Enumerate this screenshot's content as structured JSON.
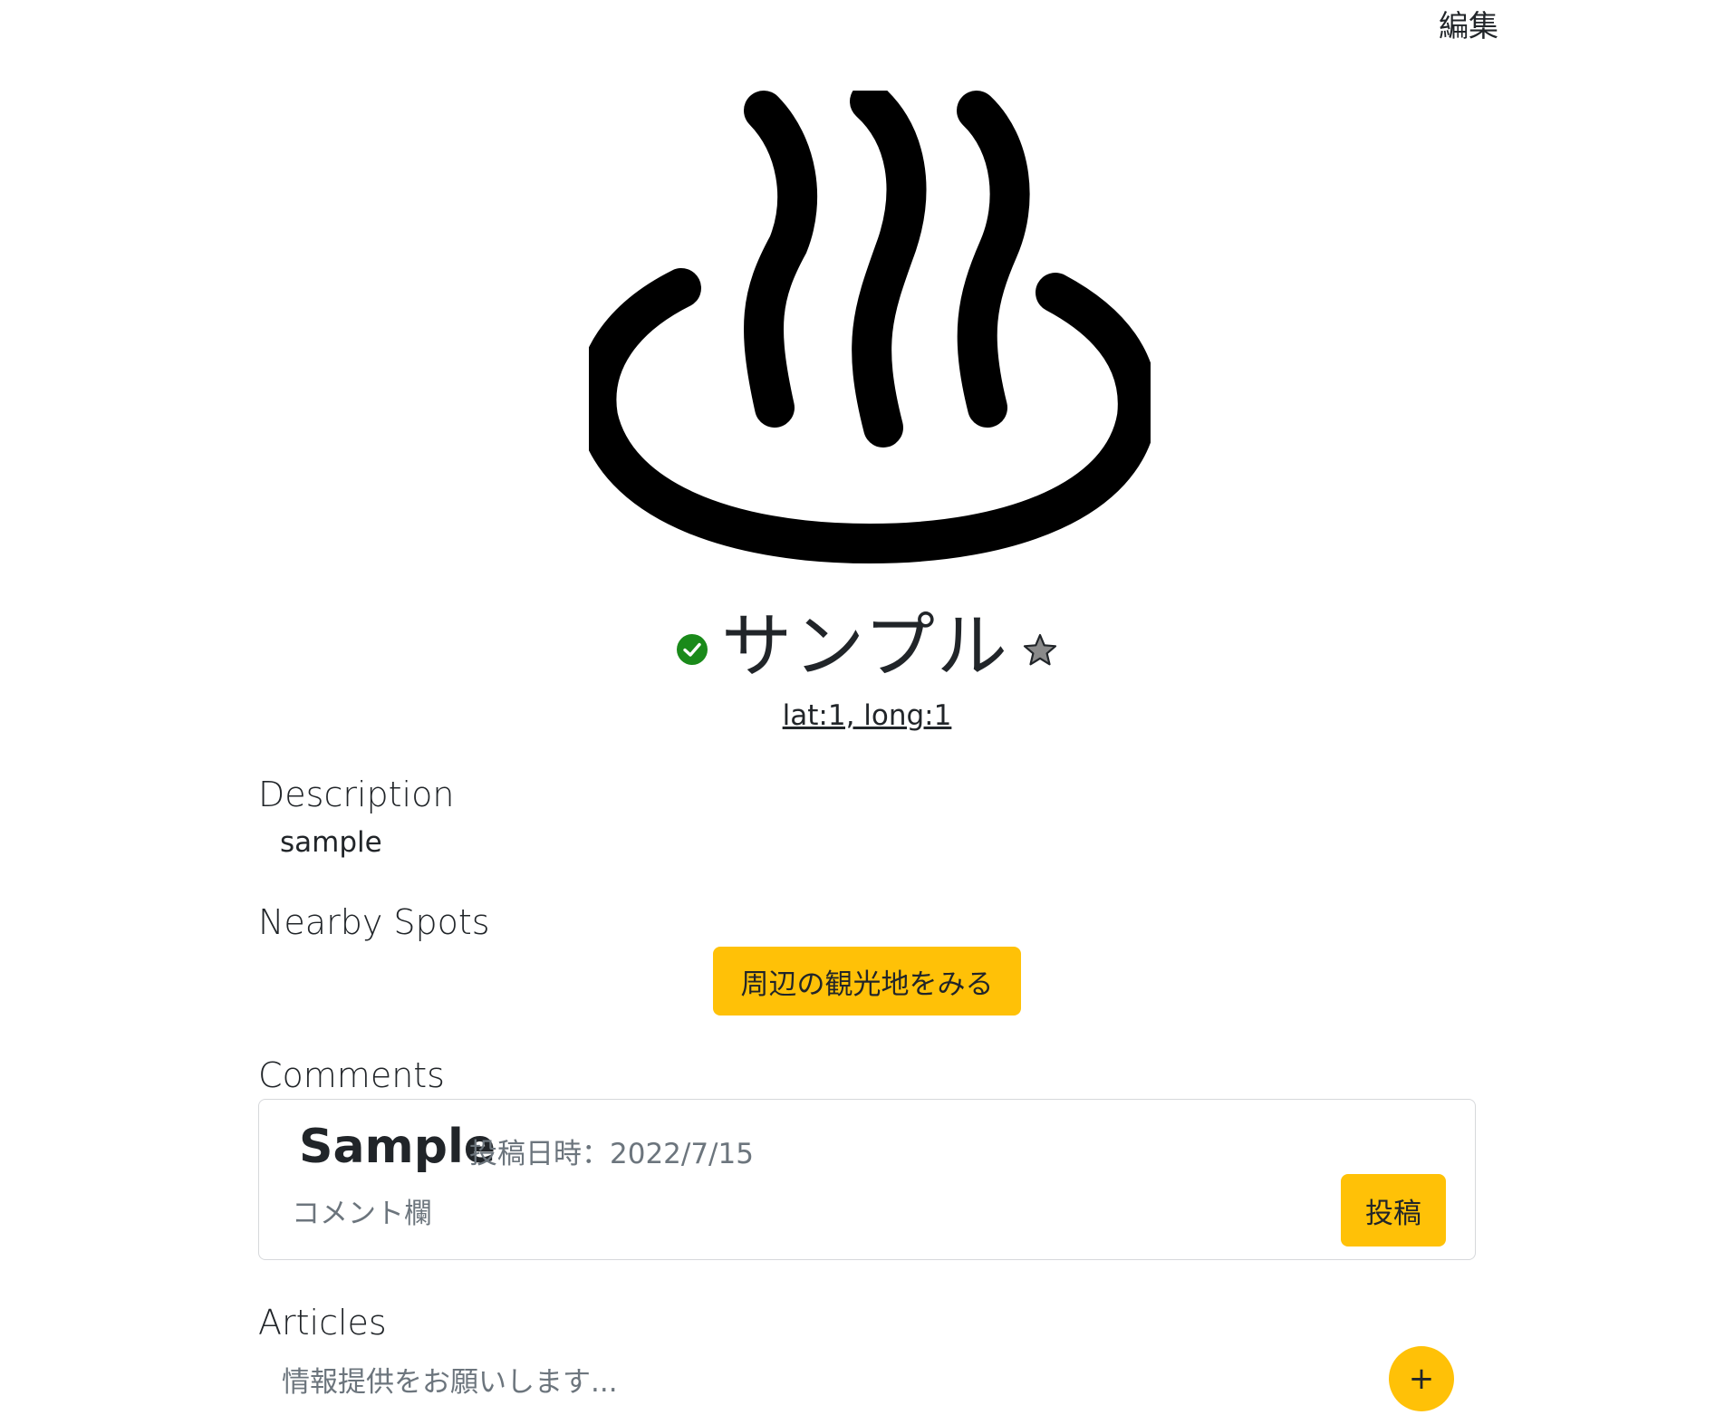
{
  "header": {
    "edit_label": "編集"
  },
  "hero": {
    "icon": "hot-spring-icon"
  },
  "spot": {
    "name": "サンプル",
    "verified_icon": "check-circle-icon",
    "favorite_icon": "star-icon",
    "coordinates": "lat:1, long:1"
  },
  "description": {
    "heading": "Description",
    "text": "sample"
  },
  "nearby": {
    "heading": "Nearby Spots",
    "button_label": "周辺の観光地をみる"
  },
  "comments": {
    "heading": "Comments",
    "author": "Sample",
    "posted_at": "投稿日時：2022/7/15",
    "input_placeholder": "コメント欄",
    "submit_label": "投稿"
  },
  "articles": {
    "heading": "Articles",
    "input_placeholder": "情報提供をお願いします...",
    "add_label": "+"
  },
  "colors": {
    "accent": "#ffc107",
    "verified": "#1a8a1a",
    "text": "#212529",
    "muted": "#6c757d"
  }
}
